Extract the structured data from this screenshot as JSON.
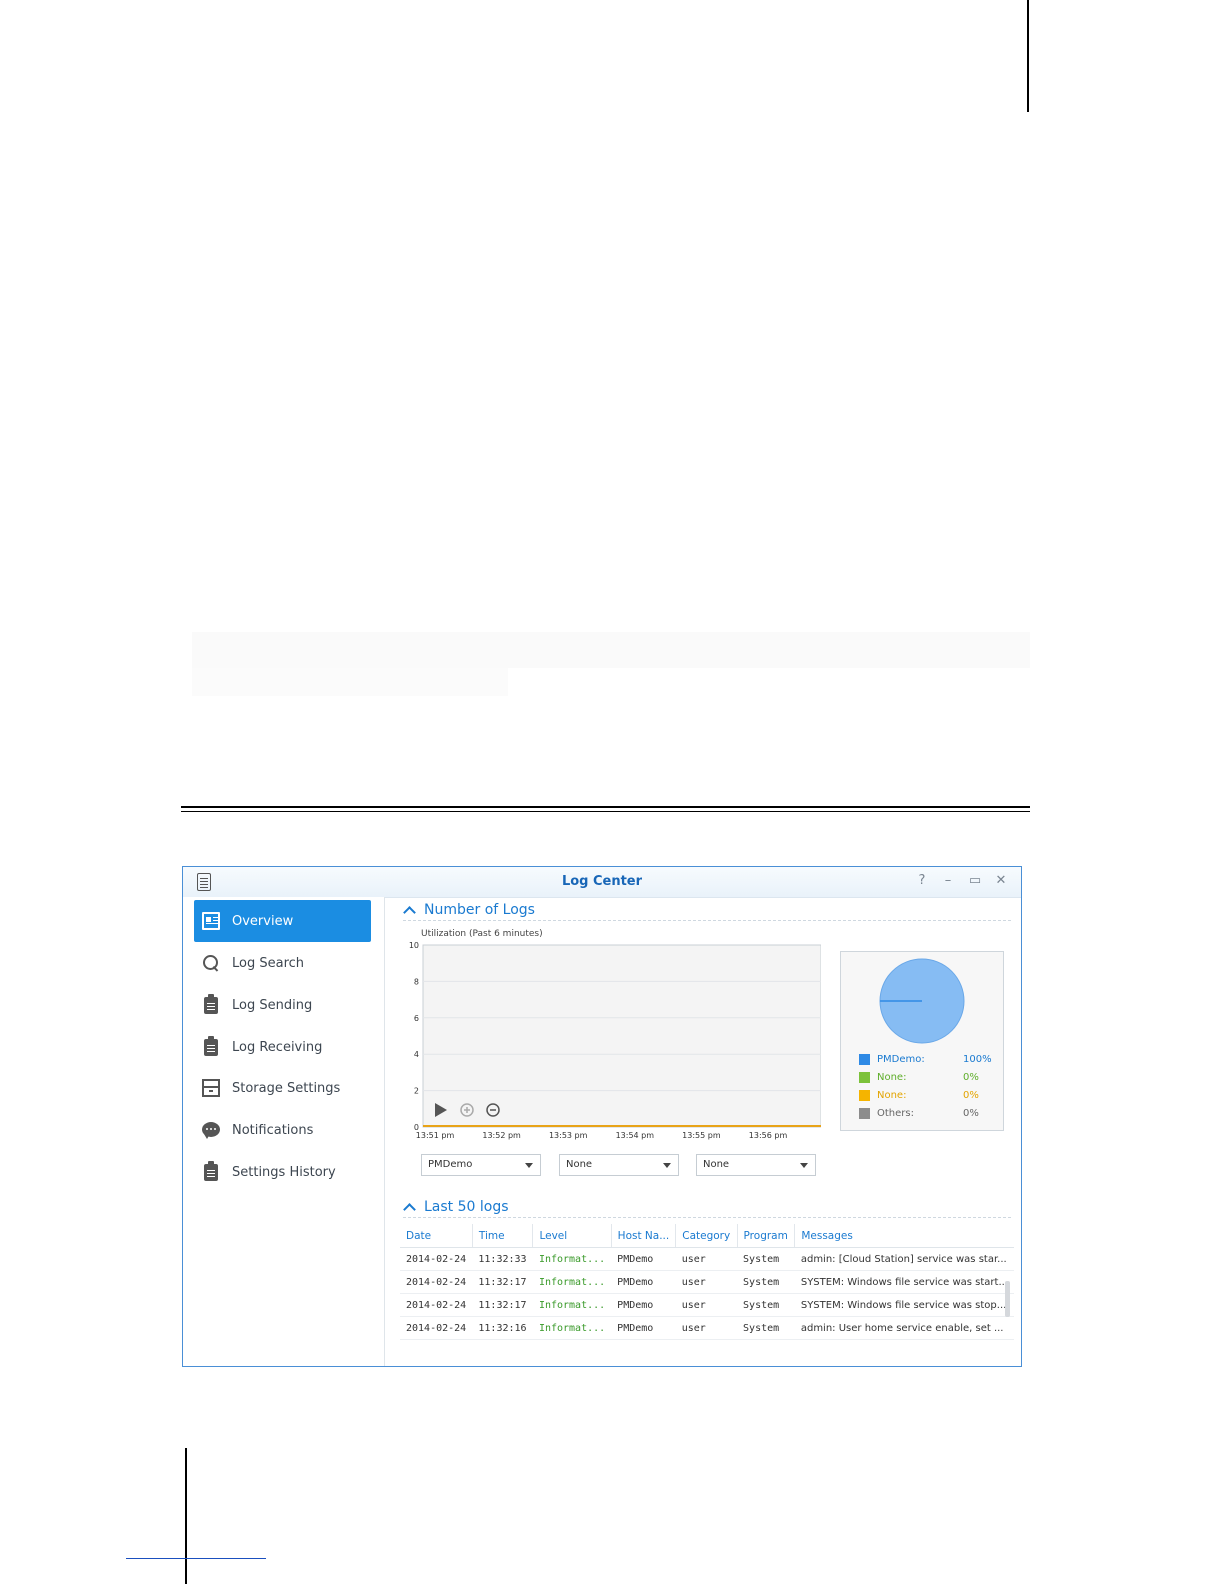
{
  "window": {
    "title": "Log Center",
    "help_label": "?",
    "minimize_label": "–",
    "maximize_label": "▭",
    "close_label": "✕"
  },
  "sidebar": {
    "items": [
      {
        "label": "Overview",
        "icon": "overview-icon",
        "active": true
      },
      {
        "label": "Log Search",
        "icon": "search-icon"
      },
      {
        "label": "Log Sending",
        "icon": "clipboard-upload-icon"
      },
      {
        "label": "Log Receiving",
        "icon": "clipboard-download-icon"
      },
      {
        "label": "Storage Settings",
        "icon": "storage-icon"
      },
      {
        "label": "Notifications",
        "icon": "chat-bubble-icon"
      },
      {
        "label": "Settings History",
        "icon": "clipboard-list-icon"
      }
    ]
  },
  "number_of_logs": {
    "heading": "Number of Logs",
    "caption": "Utilization (Past 6 minutes)"
  },
  "chart_data": {
    "type": "line",
    "title": "Utilization (Past 6 minutes)",
    "x": [
      "13:51 pm",
      "13:52 pm",
      "13:53 pm",
      "13:54 pm",
      "13:55 pm",
      "13:56 pm"
    ],
    "y_ticks": [
      0,
      2,
      4,
      6,
      8,
      10
    ],
    "ylim": [
      0,
      10
    ],
    "series": [
      {
        "values": [
          0,
          0,
          0,
          0,
          0,
          0
        ],
        "color": "#e8a317"
      }
    ],
    "grid": true
  },
  "pie": {
    "legend": [
      {
        "name": "PMDemo:",
        "pct": "100%",
        "color": "#2f8ae5",
        "text_color": "#1a7ad0",
        "value": 100
      },
      {
        "name": "None:",
        "pct": "0%",
        "color": "#7cc23a",
        "text_color": "#5fae2a",
        "value": 0
      },
      {
        "name": "None:",
        "pct": "0%",
        "color": "#f5b400",
        "text_color": "#e3a400",
        "value": 0
      },
      {
        "name": "Others:",
        "pct": "0%",
        "color": "#8c8c8c",
        "text_color": "#666666",
        "value": 0
      }
    ]
  },
  "dropdowns": [
    "PMDemo",
    "None",
    "None"
  ],
  "last_logs": {
    "heading": "Last 50 logs",
    "columns": [
      "Date",
      "Time",
      "Level",
      "Host Na...",
      "Category",
      "Program",
      "Messages"
    ],
    "rows": [
      [
        "2014-02-24",
        "11:32:33",
        "Informat...",
        "PMDemo",
        "user",
        "System",
        "admin: [Cloud Station] service was star..."
      ],
      [
        "2014-02-24",
        "11:32:17",
        "Informat...",
        "PMDemo",
        "user",
        "System",
        "SYSTEM: Windows file service was start..."
      ],
      [
        "2014-02-24",
        "11:32:17",
        "Informat...",
        "PMDemo",
        "user",
        "System",
        "SYSTEM: Windows file service was stop..."
      ],
      [
        "2014-02-24",
        "11:32:16",
        "Informat...",
        "PMDemo",
        "user",
        "System",
        "admin: User home service enable, set ..."
      ]
    ]
  }
}
